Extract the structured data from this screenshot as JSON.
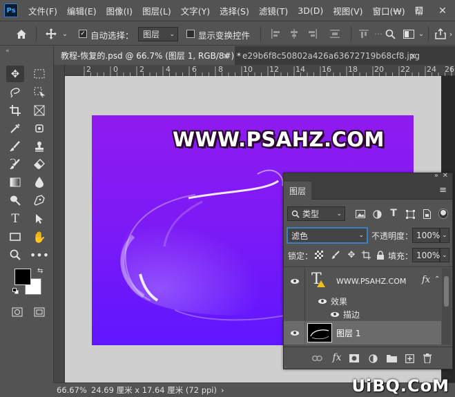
{
  "app": {
    "logo": "Ps"
  },
  "menu": [
    "文件(F)",
    "编辑(E)",
    "图像(I)",
    "图层(L)",
    "文字(Y)",
    "选择(S)",
    "滤镜(T)",
    "3D(D)",
    "视图(V)",
    "窗口(W)",
    "帮"
  ],
  "window_controls": {
    "minimize": "—",
    "maximize": "☐",
    "close": "✕"
  },
  "options": {
    "auto_select_label": "自动选择：",
    "auto_select_checked": true,
    "auto_select_target": "图层",
    "show_transform_label": "显示变换控件",
    "show_transform_checked": false
  },
  "tabs": [
    {
      "title": "教程-恢复的.psd @ 66.7% (图层 1, RGB/8#) *",
      "active": true,
      "close": "×"
    },
    {
      "title": "e29b6f8c50802a426a63672719b68cf8.jpg",
      "active": false,
      "close": "×"
    }
  ],
  "ruler": {
    "top": [
      "2",
      "0",
      "2",
      "4",
      "6",
      "8",
      "10",
      "12",
      "14",
      "16",
      "18",
      "20",
      "22",
      "24",
      "26"
    ]
  },
  "canvas": {
    "text": "WWW.PSAHZ.COM",
    "background_top": "#8f1bf0",
    "background_bottom": "#5f16ff"
  },
  "status": {
    "zoom": "66.67%",
    "doc_info": "24.69 厘米 x 17.64 厘米 (72 ppi)",
    "arrow": "›"
  },
  "layers_panel": {
    "tab_title": "图层",
    "filter_kind": "类型",
    "blend_mode": "滤色",
    "opacity_label": "不透明度：",
    "opacity_value": "100%",
    "lock_label": "锁定：",
    "fill_label": "填充：",
    "fill_value": "100%",
    "layers": [
      {
        "name": "WWW.PSAHZ.COM",
        "type": "text",
        "fx": "fx",
        "warning": true
      },
      {
        "name": "效果",
        "type": "effects-group"
      },
      {
        "name": "描边",
        "type": "effect"
      },
      {
        "name": "图层 1",
        "type": "pixel",
        "selected": true
      }
    ],
    "footer_icons": [
      "link-icon",
      "fx-icon",
      "mask-icon",
      "adjustment-icon",
      "folder-icon",
      "new-layer-icon",
      "trash-icon"
    ]
  },
  "watermark": "UiBQ.CoM",
  "colors": {
    "foreground": "#000000",
    "background": "#ffffff",
    "accent": "#31a8ff"
  }
}
